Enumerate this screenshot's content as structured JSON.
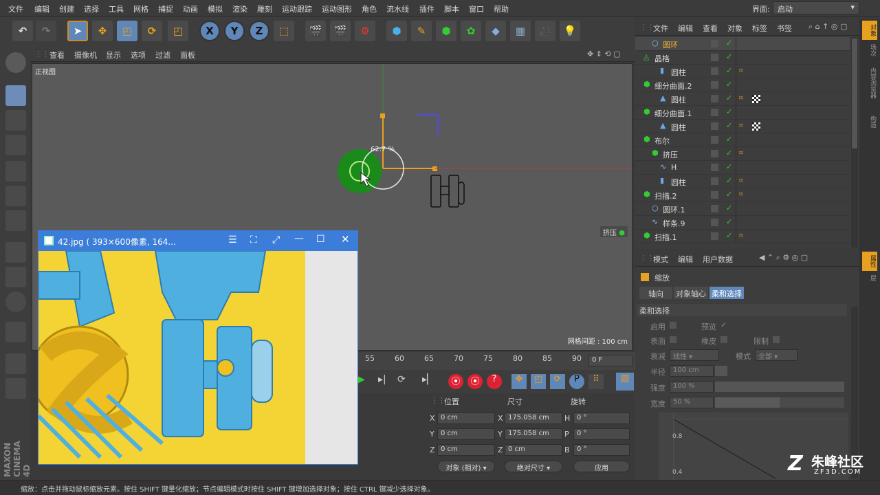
{
  "menu": {
    "items": [
      "文件",
      "编辑",
      "创建",
      "选择",
      "工具",
      "网格",
      "捕捉",
      "动画",
      "模拟",
      "渲染",
      "雕刻",
      "运动跟踪",
      "运动图形",
      "角色",
      "流水线",
      "插件",
      "脚本",
      "窗口",
      "帮助"
    ],
    "layout_label": "界面:",
    "layout_value": "启动"
  },
  "toolbar": {
    "x": "X",
    "y": "Y",
    "z": "Z"
  },
  "viewport": {
    "menu": [
      "查看",
      "摄像机",
      "显示",
      "选项",
      "过滤",
      "面板"
    ],
    "view_name": "正视图",
    "scale_hud": "62.7 %",
    "grid_info": "网格间距 : 100 cm",
    "extrude_tag": "挤压"
  },
  "timeline": {
    "ticks": [
      "55",
      "60",
      "65",
      "70",
      "75",
      "80",
      "85",
      "90"
    ],
    "frame": "0 F"
  },
  "coords": {
    "headers": [
      "位置",
      "尺寸",
      "旋转"
    ],
    "rows": [
      {
        "axis": "X",
        "pos": "0 cm",
        "size_axis": "X",
        "size": "175.058 cm",
        "rot_axis": "H",
        "rot": "0 °"
      },
      {
        "axis": "Y",
        "pos": "0 cm",
        "size_axis": "Y",
        "size": "175.058 cm",
        "rot_axis": "P",
        "rot": "0 °"
      },
      {
        "axis": "Z",
        "pos": "0 cm",
        "size_axis": "Z",
        "size": "0 cm",
        "rot_axis": "B",
        "rot": "0 °"
      }
    ],
    "mode": "对象 (相对)",
    "size_mode": "绝对尺寸",
    "apply": "应用"
  },
  "objects": {
    "menu": [
      "文件",
      "编辑",
      "查看",
      "对象",
      "标签",
      "书签"
    ],
    "items": [
      {
        "name": "圆环",
        "indent": 1,
        "icon": "circle"
      },
      {
        "name": "晶格",
        "indent": 0,
        "icon": "lattice"
      },
      {
        "name": "圆柱",
        "indent": 2,
        "icon": "cylinder"
      },
      {
        "name": "细分曲面.2",
        "indent": 0,
        "icon": "subdiv"
      },
      {
        "name": "圆柱",
        "indent": 2,
        "icon": "cone"
      },
      {
        "name": "细分曲面.1",
        "indent": 0,
        "icon": "subdiv"
      },
      {
        "name": "圆柱",
        "indent": 2,
        "icon": "cone"
      },
      {
        "name": "布尔",
        "indent": 0,
        "icon": "boole"
      },
      {
        "name": "挤压",
        "indent": 1,
        "icon": "extrude"
      },
      {
        "name": "H",
        "indent": 2,
        "icon": "spline"
      },
      {
        "name": "圆柱",
        "indent": 2,
        "icon": "cylinder"
      },
      {
        "name": "扫描.2",
        "indent": 0,
        "icon": "sweep"
      },
      {
        "name": "圆环.1",
        "indent": 1,
        "icon": "circle"
      },
      {
        "name": "样条.9",
        "indent": 1,
        "icon": "spline"
      },
      {
        "name": "扫描.1",
        "indent": 0,
        "icon": "sweep"
      }
    ]
  },
  "attributes": {
    "menu": [
      "模式",
      "编辑",
      "用户数据"
    ],
    "title": "缩放",
    "tabs": [
      "轴向",
      "对象轴心",
      "柔和选择"
    ],
    "section": "柔和选择",
    "labels": {
      "enable": "启用",
      "preview": "预览",
      "surface": "表面",
      "rubber": "橡皮",
      "limit": "限制",
      "falloff": "衰减",
      "falloff_val": "线性",
      "mode": "模式",
      "mode_val": "全部",
      "radius": "半径",
      "radius_val": "100 cm",
      "strength": "强度",
      "strength_val": "100 %",
      "width": "宽度",
      "width_val": "50 %",
      "graph_y1": "0.8",
      "graph_y2": "0.4"
    }
  },
  "right_tabs": [
    "对象",
    "场次",
    "内容浏览器",
    "构造"
  ],
  "right_tabs2": [
    "属性",
    "层"
  ],
  "image_window": {
    "title": "42.jpg ( 393×600像素, 164..."
  },
  "status": "缩放：点击并拖动鼠标缩放元素。按住 SHIFT 键量化缩放；节点编辑模式时按住 SHIFT 键增加选择对象；按住 CTRL 键减少选择对象。",
  "watermark": {
    "text": "朱峰社区",
    "url": "ZF3D.COM"
  },
  "brand": "MAXON CINEMA 4D"
}
